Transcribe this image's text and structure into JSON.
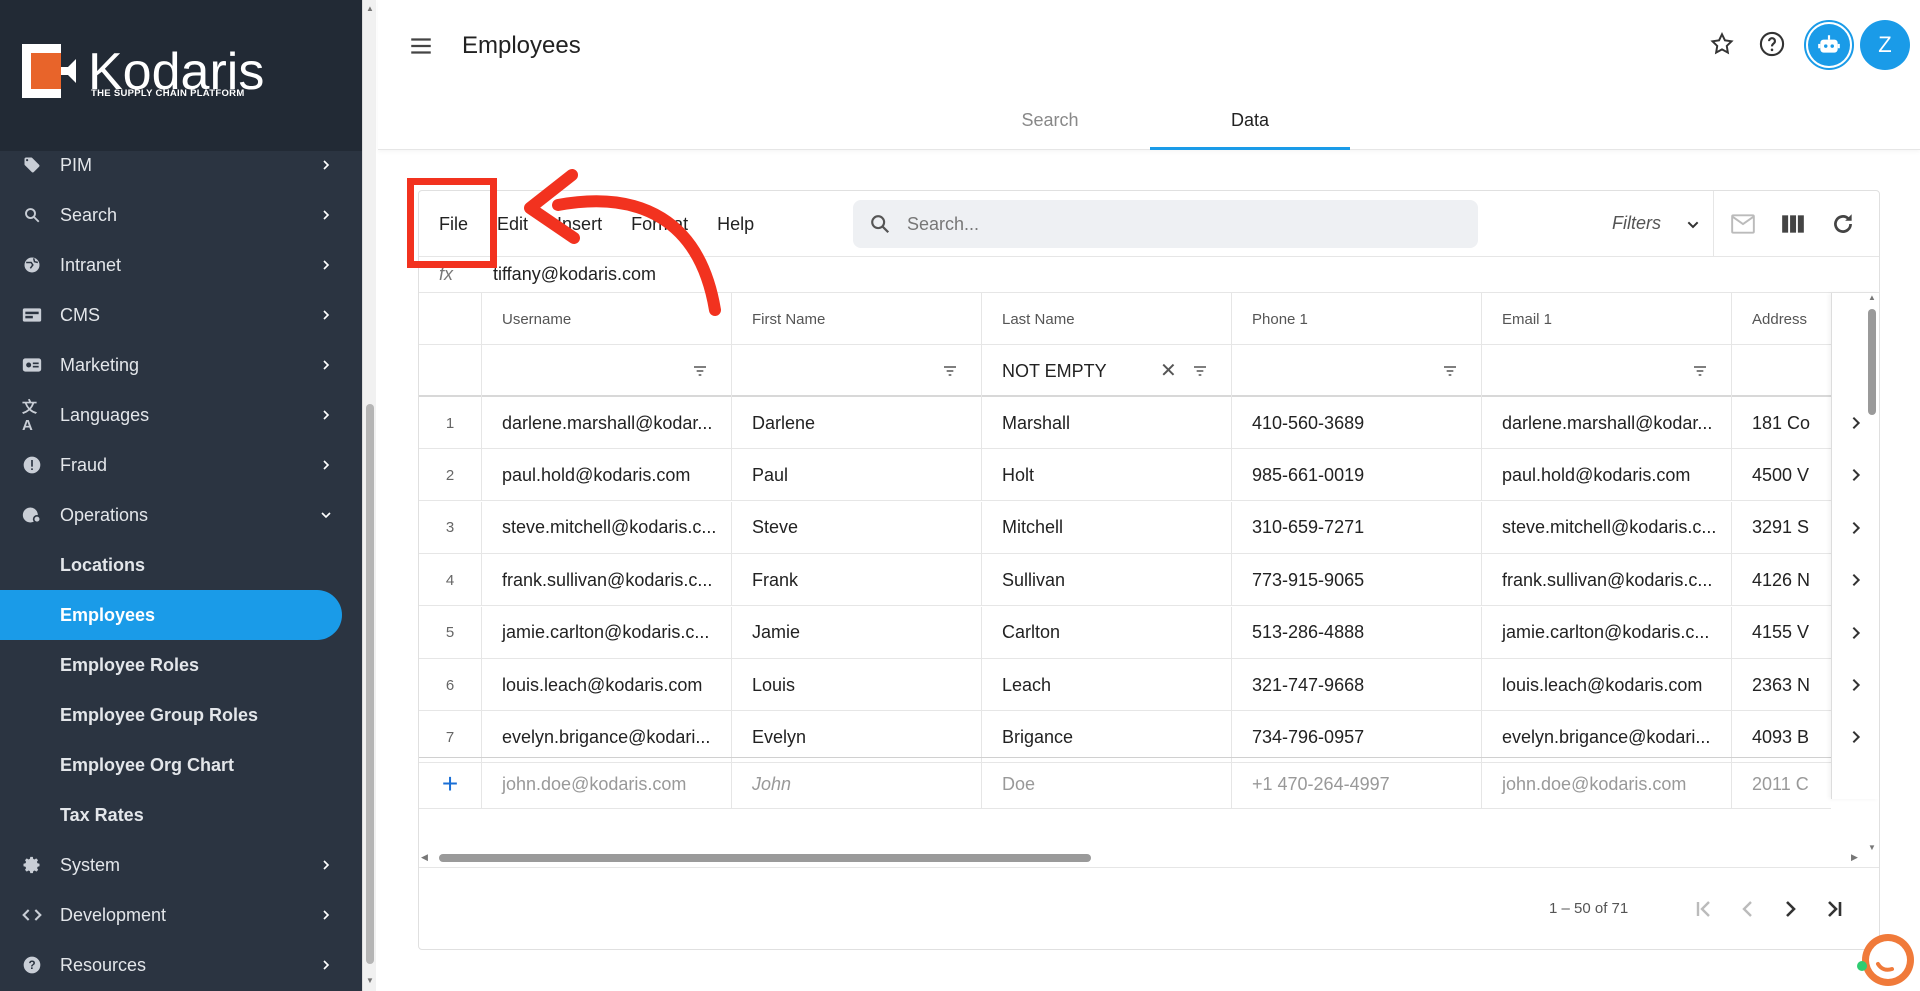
{
  "brand": {
    "name": "Kodaris",
    "tagline": "THE SUPPLY CHAIN PLATFORM"
  },
  "sidebar": {
    "items": [
      {
        "label": "PIM",
        "icon": "tag-icon"
      },
      {
        "label": "Search",
        "icon": "search-icon"
      },
      {
        "label": "Intranet",
        "icon": "globe-icon"
      },
      {
        "label": "CMS",
        "icon": "cms-icon"
      },
      {
        "label": "Marketing",
        "icon": "marketing-icon"
      },
      {
        "label": "Languages",
        "icon": "translate-icon"
      },
      {
        "label": "Fraud",
        "icon": "alert-icon"
      },
      {
        "label": "Operations",
        "icon": "operations-icon"
      }
    ],
    "operations_sub": [
      "Locations",
      "Employees",
      "Employee Roles",
      "Employee Group Roles",
      "Employee Org Chart",
      "Tax Rates"
    ],
    "bottom_items": [
      {
        "label": "System",
        "icon": "gear-icon"
      },
      {
        "label": "Development",
        "icon": "code-icon"
      },
      {
        "label": "Resources",
        "icon": "help-circle-icon"
      }
    ]
  },
  "header": {
    "title": "Employees",
    "avatar_letter": "Z",
    "tabs": [
      "Search",
      "Data"
    ],
    "active_tab": "Data"
  },
  "toolbar": {
    "menus": [
      "File",
      "Edit",
      "Insert",
      "Format",
      "Help"
    ],
    "search_placeholder": "Search...",
    "filters_label": "Filters"
  },
  "formula_bar": {
    "fx": "fx",
    "value": "tiffany@kodaris.com"
  },
  "table": {
    "columns": [
      "Username",
      "First Name",
      "Last Name",
      "Phone 1",
      "Email 1",
      "Address"
    ],
    "filter_values": [
      "",
      "",
      "NOT EMPTY",
      "",
      "",
      ""
    ],
    "rows": [
      [
        "1",
        "darlene.marshall@kodar...",
        "Darlene",
        "Marshall",
        "410-560-3689",
        "darlene.marshall@kodar...",
        "181 Co"
      ],
      [
        "2",
        "paul.hold@kodaris.com",
        "Paul",
        "Holt",
        "985-661-0019",
        "paul.hold@kodaris.com",
        "4500 V"
      ],
      [
        "3",
        "steve.mitchell@kodaris.c...",
        "Steve",
        "Mitchell",
        "310-659-7271",
        "steve.mitchell@kodaris.c...",
        "3291 S"
      ],
      [
        "4",
        "frank.sullivan@kodaris.c...",
        "Frank",
        "Sullivan",
        "773-915-9065",
        "frank.sullivan@kodaris.c...",
        "4126 N"
      ],
      [
        "5",
        "jamie.carlton@kodaris.c...",
        "Jamie",
        "Carlton",
        "513-286-4888",
        "jamie.carlton@kodaris.c...",
        "4155 V"
      ],
      [
        "6",
        "louis.leach@kodaris.com",
        "Louis",
        "Leach",
        "321-747-9668",
        "louis.leach@kodaris.com",
        "2363 N"
      ],
      [
        "7",
        "evelyn.brigance@kodari...",
        "Evelyn",
        "Brigance",
        "734-796-0957",
        "evelyn.brigance@kodari...",
        "4093 B"
      ]
    ],
    "new_row": [
      "john.doe@kodaris.com",
      "John",
      "Doe",
      "+1 470-264-4997",
      "john.doe@kodaris.com",
      "2011 C"
    ]
  },
  "pagination": {
    "range": "1 – 50 of 71"
  },
  "colors": {
    "accent": "#1a9be8",
    "sidebar": "#2b3441",
    "annotation": "#f2321f"
  }
}
